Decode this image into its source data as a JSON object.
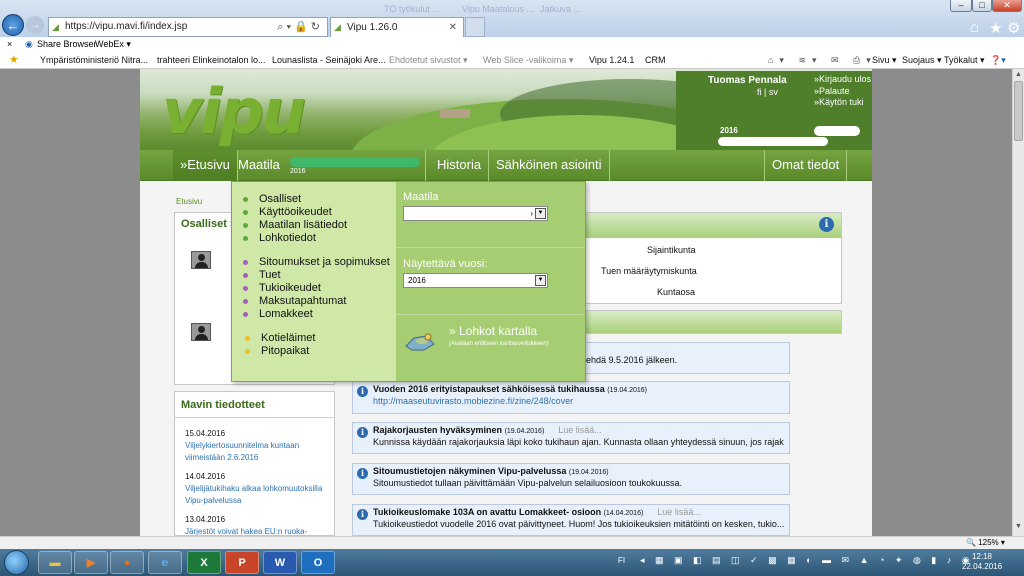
{
  "browser": {
    "url": "https://vipu.mavi.fi/index.jsp",
    "tab_title": "Vipu 1.26.0",
    "faded_tabs": [
      "TO työkulut ...",
      "Vipu Maatalous ...",
      "Jatkuva ..."
    ],
    "command_bar": {
      "close": "×",
      "share": "Share Browser",
      "webex": "WebEx ▾"
    },
    "favorites": [
      {
        "label": "Ympäristöministeriö  Nitra...",
        "grey": false
      },
      {
        "label": "trahteeri Elinkeinotalon lo...",
        "grey": false
      },
      {
        "label": "Lounaslista - Seinäjoki Are...",
        "grey": false
      },
      {
        "label": "Ehdotetut sivustot ▾",
        "grey": true
      },
      {
        "label": "Web Slice -valikoima ▾",
        "grey": true
      },
      {
        "label": "Vipu 1.24.1",
        "grey": false
      },
      {
        "label": "CRM",
        "grey": false
      }
    ],
    "tools": {
      "sivu": "Sivu ▾",
      "suojaus": "Suojaus ▾",
      "tyokalut": "Työkalut ▾"
    }
  },
  "header": {
    "logo": "vipu",
    "user_name": "Tuomas Pennala",
    "lang": "fi | sv",
    "links": [
      "»Kirjaudu ulos",
      "»Palaute",
      "»Käytön tuki"
    ],
    "year": "2016"
  },
  "nav": {
    "items": [
      "»Etusivu",
      "Maatila",
      "Historia",
      "Sähköinen asiointi",
      "Omat tiedot"
    ],
    "farm_year": "2016"
  },
  "breadcrumb": "Etusivu",
  "left_panel": {
    "title": "Osalliset »"
  },
  "news": {
    "title": "Mavin tiedotteet",
    "items": [
      {
        "date": "15.04.2016",
        "text": "Viljelykiertosuunnitelma kuntaan viimeistään 2.6.2016"
      },
      {
        "date": "14.04.2016",
        "text": "Viljelijätukihaku alkaa lohkomuutoksilla Vipu-palvelussa"
      },
      {
        "date": "13.04.2016",
        "text": "Järjestöt voivat hakea EU:n ruoka-"
      }
    ]
  },
  "main_panel": {
    "labels": [
      "Sijaintikunta",
      "Tuen määräytymiskunta",
      "Kuntaosa"
    ]
  },
  "notices": [
    {
      "title": "",
      "date": "",
      "more": "",
      "body": "sta tehdä 9.5.2016 jälkeen.",
      "link": false
    },
    {
      "title": "Vuoden 2016 erityistapaukset sähköisessä tukihaussa",
      "date": "(19.04.2016)",
      "more": "",
      "body": "http://maaseutuvirasto.mobiezine.fi/zine/248/cover",
      "link": true
    },
    {
      "title": "Rajakorjausten hyväksyminen",
      "date": "(19.04.2016)",
      "more": "Lue lisää...",
      "body": "Kunnissa käydään rajakorjauksia läpi koko tukihaun ajan. Kunnasta ollaan yhteydessä sinuun, jos rajak",
      "link": false
    },
    {
      "title": "Sitoumustietojen näkyminen Vipu-palvelussa",
      "date": "(19.04.2016)",
      "more": "",
      "body": "Sitoumustiedot tullaan päivittämään Vipu-palvelun selailuosioon toukokuussa.",
      "link": false
    },
    {
      "title": "Tukioikeuslomake 103A on avattu Lomakkeet- osioon",
      "date": "(14.04.2016)",
      "more": "Lue lisää...",
      "body": "Tukioikeustiedot vuodelle 2016 ovat päivittyneet. Huom! Jos tukioikeuksien mitätöinti on kesken, tukio...",
      "link": false
    }
  ],
  "dropdown": {
    "group1": [
      "Osalliset",
      "Käyttöoikeudet",
      "Maatilan lisätiedot",
      "Lohkotiedot"
    ],
    "group2": [
      "Sitoumukset ja sopimukset",
      "Tuet",
      "Tukioikeudet",
      "Maksutapahtumat",
      "Lomakkeet"
    ],
    "group3": [
      "Kotieläimet",
      "Pitopaikat"
    ],
    "farm_label": "Maatila",
    "farm_value": "",
    "year_label": "Näytettävä vuosi:",
    "year_value": "2016",
    "map_link": "» Lohkot kartalla",
    "map_sub": "(Avataan erilliseen karttaoveilukkeen)"
  },
  "status": {
    "zoom": "125%"
  },
  "taskbar": {
    "lang": "FI",
    "time": "12:18",
    "date": "22.04.2016"
  },
  "colors": {
    "nav_green": "#5a8a2a",
    "menu_light": "#cfe8a8",
    "menu_dark": "#a6cd72",
    "link_blue": "#2a72b5",
    "info_blue": "#2c6bb0"
  }
}
